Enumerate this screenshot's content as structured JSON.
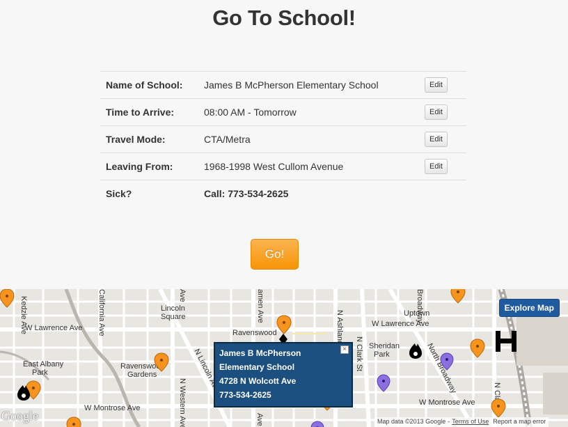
{
  "title": "Go To School!",
  "details": {
    "rows": [
      {
        "label": "Name of School:",
        "value": "James B McPherson Elementary School",
        "action": "Edit"
      },
      {
        "label": "Time to Arrive:",
        "value": "08:00 AM - Tomorrow",
        "action": "Edit"
      },
      {
        "label": "Travel Mode:",
        "value": "CTA/Metra",
        "action": "Edit"
      },
      {
        "label": "Leaving From:",
        "value": "1968-1998 West Cullom Avenue",
        "action": "Edit"
      },
      {
        "label": "Sick?",
        "value": "Call: 773-534-2625"
      }
    ]
  },
  "go_button": "Go!",
  "map": {
    "explore_button": "Explore Map",
    "info_window": {
      "line1": "James B McPherson",
      "line2": "Elementary School",
      "line3": "4728 N Wolcott Ave",
      "line4": "773-534-2625",
      "close": "×"
    },
    "labels": {
      "w_lawrence_ave_left": "W Lawrence Ave",
      "w_lawrence_ave_right": "W Lawrence Ave",
      "lincoln_square_1": "Lincoln",
      "lincoln_square_2": "Square",
      "ravenswood": "Ravenswood",
      "ravenswood_gardens_1": "Ravenswood",
      "ravenswood_gardens_2": "Gardens",
      "east_albany_park_1": "East Albany",
      "east_albany_park_2": "Park",
      "w_montrose_ave_left": "W Montrose Ave",
      "w_montrose_ave_right": "W Montrose Ave",
      "uptown": "Uptown",
      "sheridan_park_1": "Sheridan",
      "sheridan_park_2": "Park",
      "n_kedzie_ave": "Kedzie Ave",
      "california_ave": "California Ave",
      "n_lincoln_ave": "N Lincoln Ave",
      "n_western_ave": "N Western Ave",
      "n_ashland_ave": "N Ashland Ave",
      "n_clark_st": "N Clark St",
      "n_broadway": "North Broadway",
      "broadway_top": "Broadway",
      "ravenswood_ave": "amen Ave",
      "n_cla": "N Cla",
      "ave_a": "Ave",
      "ave_b": "Ave"
    },
    "footer": {
      "map_data": "Map data ©2013 Google",
      "terms": "Terms of Use",
      "report": "Report a map error"
    },
    "google_logo": "Google",
    "colors": {
      "marker_orange": "#f7941d",
      "marker_purple": "#8b6fe0",
      "info_window_bg": "#1b4f80",
      "explore_bg": "#1f5b9e"
    }
  }
}
